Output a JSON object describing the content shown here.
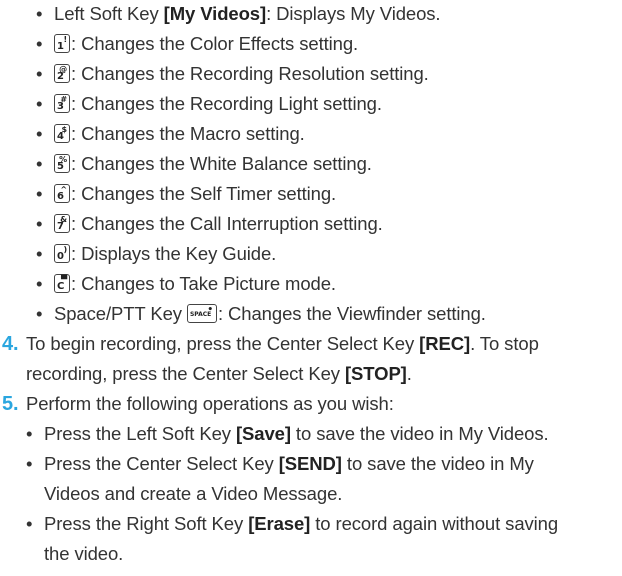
{
  "bullet_char": "•",
  "sub_items": [
    {
      "prefix": "Left Soft Key ",
      "key": "[My Videos]",
      "desc": ": Displays My Videos."
    },
    {
      "cap_main": "1",
      "cap_sup": "!",
      "desc": ": Changes the Color Effects setting."
    },
    {
      "cap_main": "2",
      "cap_sup": "@",
      "desc": ": Changes the Recording Resolution setting."
    },
    {
      "cap_main": "3",
      "cap_sup": "#",
      "desc": ": Changes the Recording Light setting."
    },
    {
      "cap_main": "4",
      "cap_sup": "$",
      "desc": ": Changes the Macro setting."
    },
    {
      "cap_main": "5",
      "cap_sup": "%",
      "desc": ": Changes the White Balance setting."
    },
    {
      "cap_main": "6",
      "cap_sup": "^",
      "desc": ": Changes the Self Timer setting."
    },
    {
      "cap_main": "7",
      "cap_sup": "&",
      "desc": ": Changes the Call Interruption setting."
    },
    {
      "cap_main": "0",
      "cap_sup": ")",
      "desc": ": Displays the Key Guide."
    },
    {
      "cap_main": "C",
      "cap_sup": "▀",
      "desc": ": Changes to Take Picture mode."
    },
    {
      "prefix": "Space/PTT Key ",
      "cap_main": "SPACE",
      "cap_sup": "•",
      "desc": ": Changes the Viewfinder setting."
    }
  ],
  "step4": {
    "number": "4.",
    "line1_pre": "To begin recording, press the Center Select Key ",
    "line1_key": "[REC]",
    "line1_post": ". To stop",
    "line2_pre": "recording, press the Center Select Key ",
    "line2_key": "[STOP]",
    "line2_post": "."
  },
  "step5": {
    "number": "5.",
    "text": "Perform the following operations as you wish:",
    "bullets": [
      {
        "l1_pre": "Press the Left Soft Key ",
        "l1_key": "[Save]",
        "l1_post": " to save the video in My Videos.",
        "l2": ""
      },
      {
        "l1_pre": "Press the Center Select Key ",
        "l1_key": "[SEND]",
        "l1_post": " to save the video in My",
        "l2": "Videos and create a Video Message."
      },
      {
        "l1_pre": "Press the Right Soft Key ",
        "l1_key": "[Erase]",
        "l1_post": " to record again without saving",
        "l2": "the video."
      }
    ]
  },
  "colors": {
    "text": "#333333",
    "step_number": "#2aa6df"
  }
}
